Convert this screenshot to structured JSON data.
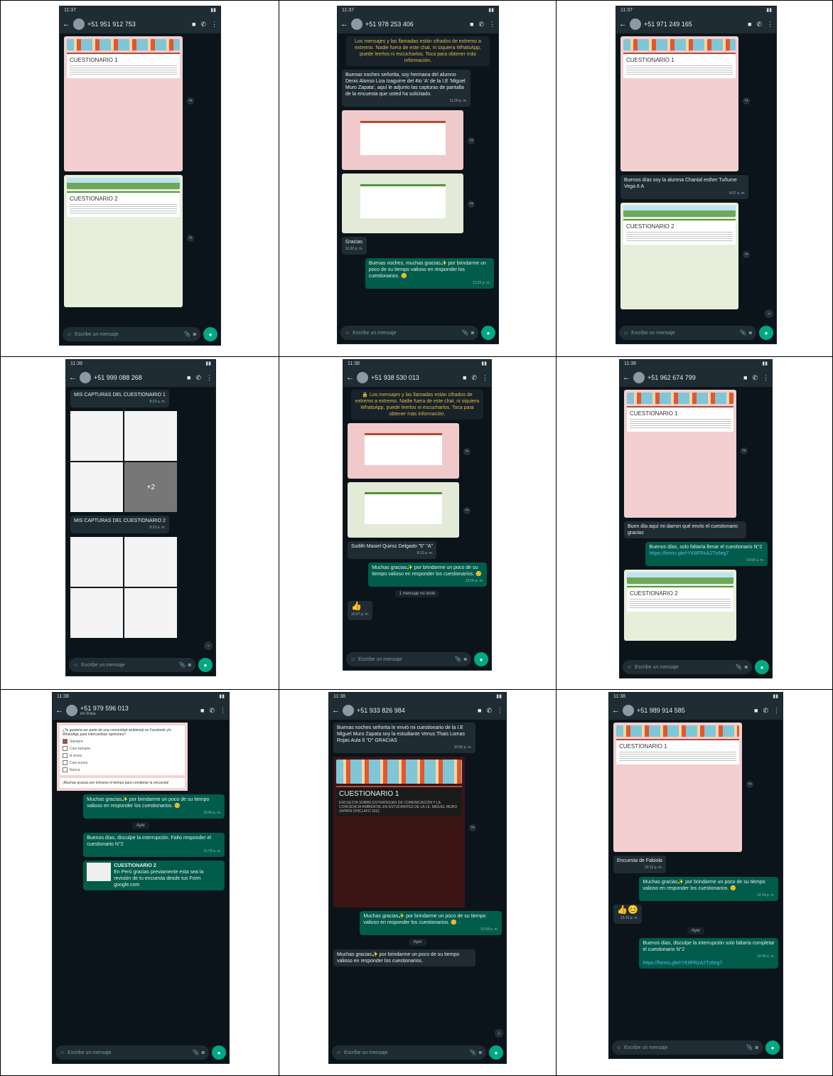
{
  "common": {
    "input_placeholder": "Escribe un mensaje",
    "forward_glyph": "↪",
    "scroll_glyph": "⌄"
  },
  "phones": {
    "p1": {
      "status_time": "11:37",
      "contact": "+51 951 912 753",
      "form1_title": "CUESTIONARIO 1",
      "form2_title": "CUESTIONARIO 2"
    },
    "p2": {
      "status_time": "11:37",
      "contact": "+51 978 253 406",
      "sys_notice": "Los mensajes y las llamadas están cifrados de extremo a extremo. Nadie fuera de este chat, ni siquiera WhatsApp, puede leerlos ni escucharlos. Toca para obtener más información.",
      "msg1": "Buenas noches señorita, soy hermana del alumno Denis Alonso Liza Izaguirre del 4to 'A' de la I.E 'Miguel Muro Zapata', aquí le adjunto las capturas de pantalla de la encuesta que usted ha solicitado.",
      "msg1_time": "11:20 p. m.",
      "msg2": "Gracias",
      "msg2_time": "11:20 p. m.",
      "msg3": "Buenas noches, muchas gracias✨ por brindarme un poco de su tiempo valioso en responder los cuestionarios. 😊",
      "msg3_time": "11:25 p. m."
    },
    "p3": {
      "status_time": "11:37",
      "contact": "+51 971 249 165",
      "form1_title": "CUESTIONARIO 1",
      "msg1": "Buenos días soy la alumna Chantal esther Tuñume Vega 6 A",
      "msg1_time": "8:07 a. m.",
      "form2_title": "CUESTIONARIO 2"
    },
    "p4": {
      "status_time": "11:38",
      "contact": "+51 999 088 268",
      "msg1": "MIS CAPTURAS DEL CUESTIONARIO 1",
      "msg1_time": "8:23 a. m.",
      "more_count": "+2",
      "msg2": "MIS CAPTURAS DEL CUESTIONARIO 2",
      "msg2_time": "8:23 a. m."
    },
    "p5": {
      "status_time": "11:38",
      "contact": "+51 938 530 013",
      "sys_notice": "🔒 Los mensajes y las llamadas están cifrados de extremo a extremo. Nadie fuera de este chat, ni siquiera WhatsApp, puede leerlos ni escucharlos. Toca para obtener más información.",
      "msg1": "Sudith Masiel Quiroz Delgado \"5\" \"A\"",
      "msg1_time": "8:12 p. m.",
      "msg2": "Muchas gracias✨ por brindarme un poco de su tiempo valioso en responder los cuestionarios. 😊",
      "msg2_time": "10:06 p. m.",
      "unread": "1 mensaje no leído",
      "msg3": "👍",
      "msg3_time": "10:07 p. m."
    },
    "p6": {
      "status_time": "11:38",
      "contact": "+51 962 674 799",
      "form1_title": "CUESTIONARIO 1",
      "msg1": "Buen día aquí mi darron qué envío el cuestionario gracias",
      "msg2": "Buenos días, solo faltaría llenar el cuestionario N°2",
      "msg2_link": "https://forms.gle/rYK8FRzA2Tz6eg7",
      "msg2_time": "10:09 a. m.",
      "form2_title": "CUESTIONARIO 2"
    },
    "p7": {
      "status_time": "11:38",
      "contact": "+51 979 596 013",
      "contact_sub": "en línea",
      "quiz_q": "¿Te gustaría ser parte de una comunidad ambiental en Facebook y/o WhatsApp para intercambiar opiniones?",
      "quiz_opts": [
        "Siempre",
        "Casi siempre",
        "A veces",
        "Casi nunca",
        "Nunca"
      ],
      "quiz_thanks": "¡Muchas gracias por tomarse el tiempo para completar la encuesta!",
      "msg1": "Muchas gracias✨ por brindarme un poco de su tiempo valioso en responder los cuestionarios. 😊",
      "msg1_time": "10:45 p. m.",
      "date": "Ayer",
      "msg2": "Buenos días, disculpe la interrupción. Falto responder el cuestionario N°2",
      "msg2_time": "11:19 a. m.",
      "link_title": "CUESTIONARIO 2",
      "link_desc": "En Perú gracias previamente esta sea la revisión de tu encuesta desde tus Form google.com"
    },
    "p8": {
      "status_time": "11:38",
      "contact": "+51 933 826 984",
      "msg1": "Buenas noches señorita le envió mi cuestionario de la I.E Miguel Muro Zapata soy la estudiante Venus Thais Lomas Rojas Aula 6 \"D\" GRACIAS",
      "msg1_time": "10:55 p. m.",
      "form1_title": "CUESTIONARIO 1",
      "form1_desc": "ENCUESTA SOBRE ESTRATEGIAS DE COMUNICACIÓN Y LA CONCIENCIA AMBIENTAL EN ESTUDIANTES DE LA I.E. MIGUEL MURO ZAPATA CHICLAYO 2021",
      "msg2": "Muchas gracias✨ por brindarme un poco de su tiempo valioso en responder los cuestionarios. 😊",
      "msg2_time": "10:58 p. m.",
      "date": "Ayer",
      "msg3": "Muchas gracias✨ por brindarme un poco de su tiempo valioso en responder los cuestionarios."
    },
    "p9": {
      "status_time": "11:38",
      "contact": "+51 989 914 585",
      "form1_title": "CUESTIONARIO 1",
      "msg1": "Encuesta de Fabiola",
      "msg1_time": "10:13 p. m.",
      "msg2": "Muchas gracias✨ por brindarme un poco de su tiempo valioso en responder los cuestionarios. 😊",
      "msg2_time": "10:14 p. m.",
      "msg3": "👍😊",
      "msg3_time": "10:15 p. m.",
      "date": "Ayer",
      "msg4": "Buenos días, disculpe la interrupción solo faltaría completar el cuestionario N°2",
      "msg4_time": "10:09 a. m.",
      "msg4_link": "https://forms.gle/rYK8FRzA2Tz6eg7"
    }
  }
}
